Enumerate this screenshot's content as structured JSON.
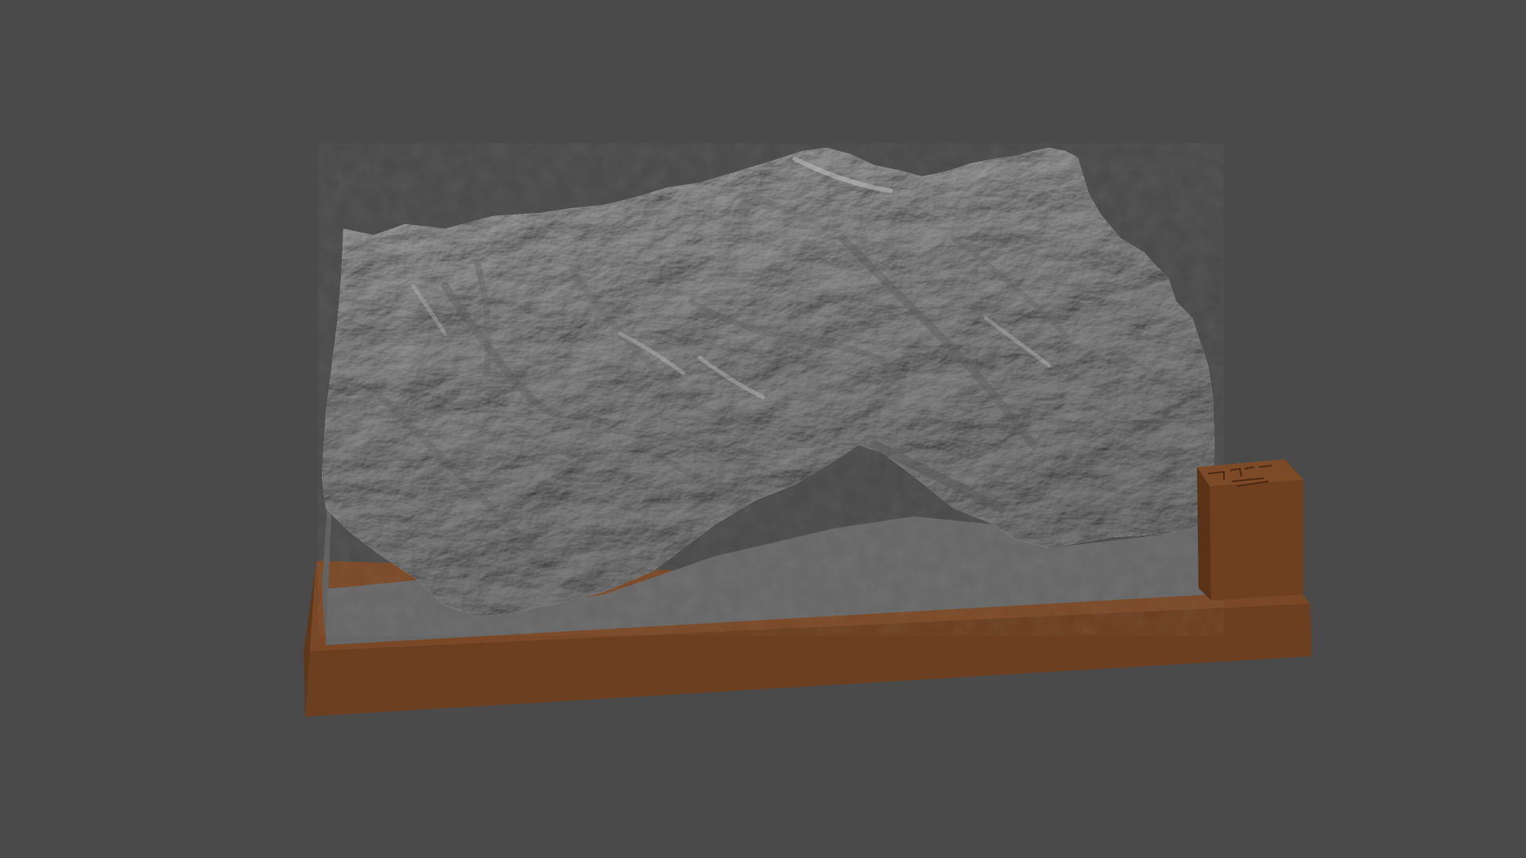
{
  "scene": {
    "background_color": "#4a4a4a",
    "subject": "terrain-relief-model",
    "terrain_color": "#8c8c8c",
    "terrain_side_color": "#676767",
    "base_color": "#6b3f1f",
    "base_top_color": "#7a4826",
    "label_block_color": "#6e4020"
  }
}
